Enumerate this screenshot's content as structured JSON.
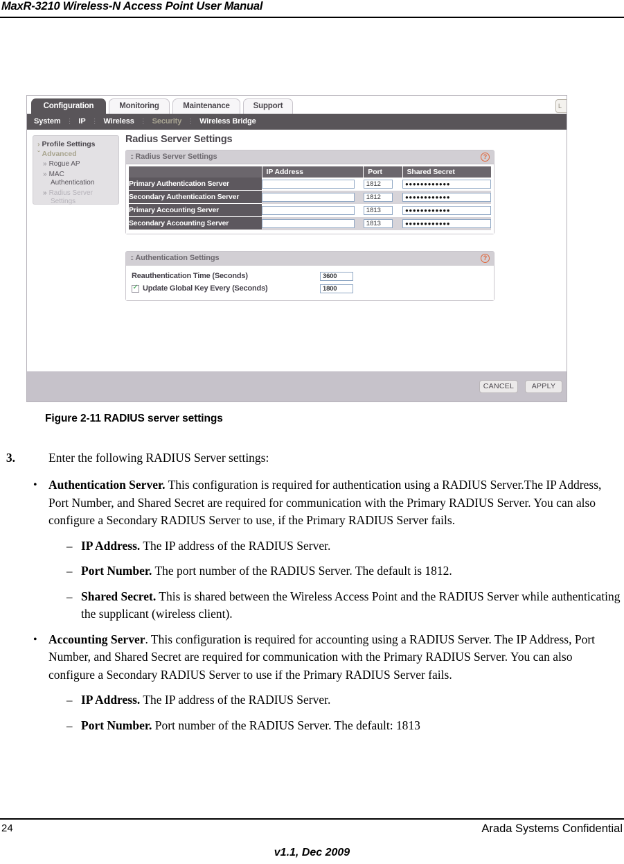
{
  "page": {
    "running_header": "MaxR-3210 Wireless-N Access Point User Manual",
    "page_number": "24",
    "confidential": "Arada Systems Confidential",
    "version": "v1.1, Dec 2009"
  },
  "figure": {
    "caption": "Figure 2-11  RADIUS server settings",
    "screenshot": {
      "tabs": [
        {
          "label": "Configuration",
          "active": true
        },
        {
          "label": "Monitoring",
          "active": false
        },
        {
          "label": "Maintenance",
          "active": false
        },
        {
          "label": "Support",
          "active": false
        }
      ],
      "logout_button": "L",
      "subnav": [
        {
          "label": "System",
          "selected": false
        },
        {
          "label": "IP",
          "selected": false
        },
        {
          "label": "Wireless",
          "selected": false
        },
        {
          "label": "Security",
          "selected": true
        },
        {
          "label": "Wireless Bridge",
          "selected": false
        }
      ],
      "sidebar": {
        "profile_settings": {
          "caret": "›",
          "label": "Profile Settings"
        },
        "advanced": {
          "caret": "ˇ",
          "label": "Advanced"
        },
        "sub_items": [
          {
            "bullet": "»",
            "label": "Rogue AP",
            "line2": "",
            "selected": false
          },
          {
            "bullet": "»",
            "label": "MAC",
            "line2": "Authentication",
            "selected": false
          },
          {
            "bullet": "»",
            "label": "Radius Server",
            "line2": "Settings",
            "selected": true
          }
        ]
      },
      "content_title": "Radius Server Settings",
      "radius_panel": {
        "title": "Radius Server Settings",
        "grip": "::",
        "help": "?",
        "columns": [
          "",
          "IP Address",
          "Port",
          "Shared Secret"
        ],
        "rows": [
          {
            "label": "Primary Authentication Server",
            "ip": "",
            "port": "1812",
            "secret": "●●●●●●●●●●●●"
          },
          {
            "label": "Secondary Authentication Server",
            "ip": "",
            "port": "1812",
            "secret": "●●●●●●●●●●●●"
          },
          {
            "label": "Primary Accounting Server",
            "ip": "",
            "port": "1813",
            "secret": "●●●●●●●●●●●●"
          },
          {
            "label": "Secondary Accounting Server",
            "ip": "",
            "port": "1813",
            "secret": "●●●●●●●●●●●●"
          }
        ]
      },
      "auth_panel": {
        "title": "Authentication Settings",
        "grip": "::",
        "help": "?",
        "reauth_label": "Reauthentication Time (Seconds)",
        "reauth_value": "3600",
        "global_key_label": "Update Global Key Every (Seconds)",
        "global_key_value": "1800",
        "global_key_checked": true
      },
      "buttons": {
        "cancel": "CANCEL",
        "apply": "APPLY"
      }
    }
  },
  "body": {
    "step": {
      "number": "3.",
      "text": "Enter the following RADIUS Server settings:"
    },
    "items": [
      {
        "mark": "•",
        "lead": "Authentication Server.",
        "text": " This configuration is required for authentication using a RADIUS Server.The IP Address, Port Number, and Shared Secret are required for communication with the Primary RADIUS Server. You can also configure a Secondary RADIUS Server to use, if the Primary RADIUS Server fails."
      },
      {
        "mark": "•",
        "lead": "Accounting Server",
        "text": ". This configuration is required for accounting using a RADIUS Server. The IP Address, Port Number, and Shared Secret are required for communication with the Primary RADIUS Server. You can also configure a Secondary RADIUS Server to use if the Primary RADIUS Server fails."
      }
    ],
    "sub_items_auth": [
      {
        "mark": "–",
        "lead": "IP Address.",
        "text": " The IP address of the RADIUS Server."
      },
      {
        "mark": "–",
        "lead": "Port Number.",
        "text": " The port number of the RADIUS Server. The default is 1812."
      },
      {
        "mark": "–",
        "lead": "Shared Secret.",
        "text": " This is shared between the Wireless Access Point and the RADIUS Server while authenticating the supplicant (wireless client)."
      }
    ],
    "sub_items_acct": [
      {
        "mark": "–",
        "lead": "IP Address.",
        "text": " The IP address of the RADIUS Server."
      },
      {
        "mark": "–",
        "lead": "Port Number.",
        "text": " Port number of the RADIUS Server. The default: 1813"
      }
    ]
  },
  "colors": {
    "nav_dark": "#595559",
    "table_header": "#6b666c",
    "row_label": "#5d585e",
    "panel_head": "#d2cfd4",
    "accent_help": "#e0653a",
    "bottom_bar": "#c6c2ca",
    "selected_nav": "#a9a593"
  }
}
